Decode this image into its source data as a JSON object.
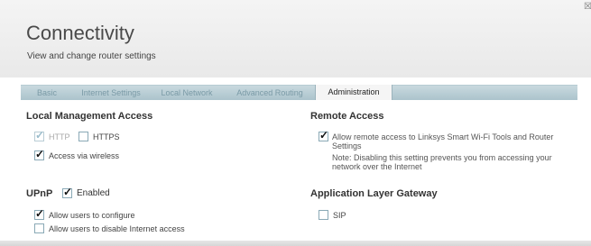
{
  "page": {
    "title": "Connectivity",
    "subtitle": "View and change router settings",
    "close_icon": "close-icon"
  },
  "tabs": [
    {
      "label": "Basic",
      "active": false
    },
    {
      "label": "Internet Settings",
      "active": false
    },
    {
      "label": "Local Network",
      "active": false
    },
    {
      "label": "Advanced Routing",
      "active": false
    },
    {
      "label": "Administration",
      "active": true
    }
  ],
  "local_management": {
    "heading": "Local Management Access",
    "http": {
      "label": "HTTP",
      "checked": true,
      "enabled": false
    },
    "https": {
      "label": "HTTPS",
      "checked": false,
      "enabled": true
    },
    "wireless": {
      "label": "Access via wireless",
      "checked": true,
      "enabled": true
    }
  },
  "remote_access": {
    "heading": "Remote Access",
    "allow": {
      "label": "Allow remote access to Linksys Smart Wi-Fi Tools and Router Settings",
      "checked": true
    },
    "note": "Note: Disabling this setting prevents you from accessing your network over the Internet"
  },
  "upnp": {
    "heading": "UPnP",
    "enabled": {
      "label": "Enabled",
      "checked": true
    },
    "configure": {
      "label": "Allow users to configure",
      "checked": true
    },
    "disable_internet": {
      "label": "Allow users to disable Internet access",
      "checked": false
    }
  },
  "alg": {
    "heading": "Application Layer Gateway",
    "sip": {
      "label": "SIP",
      "checked": false
    }
  },
  "colors": {
    "tab_bar": "#b6cbd3",
    "tab_inactive_text": "#7a9aa6",
    "header_bg": "#efefef"
  }
}
